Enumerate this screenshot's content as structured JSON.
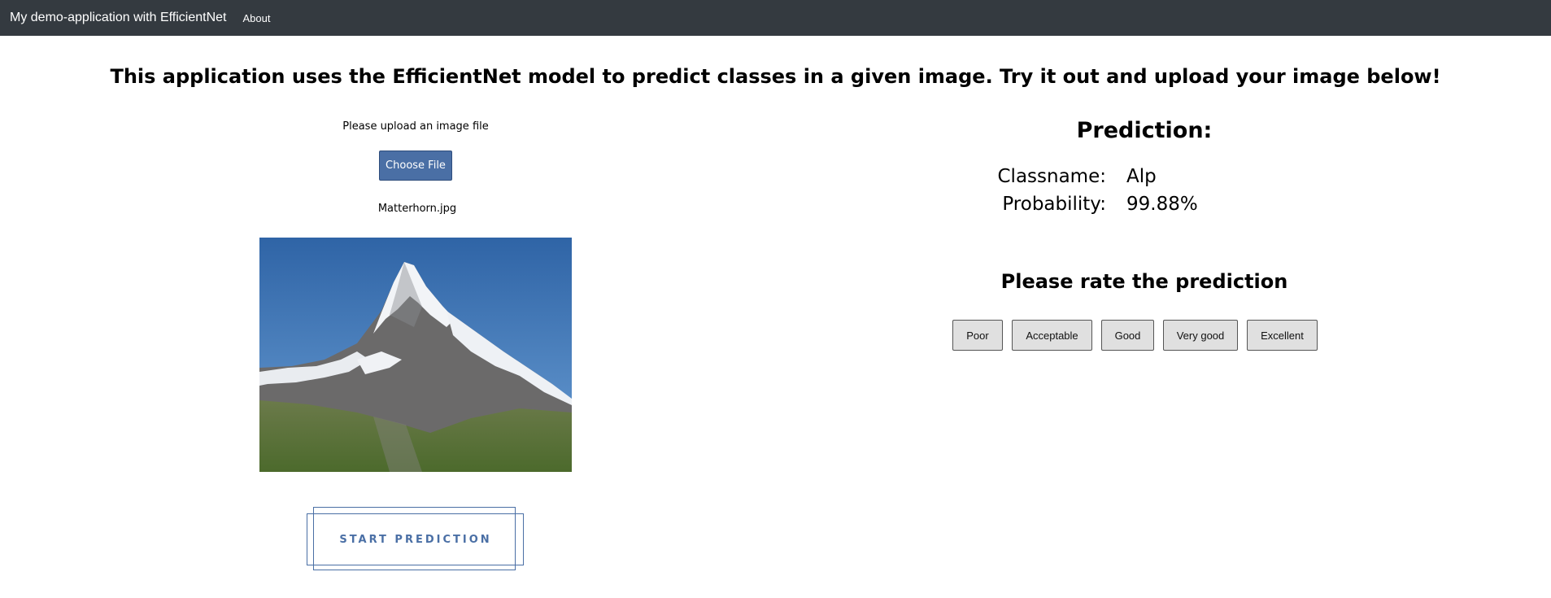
{
  "navbar": {
    "brand": "My demo-application with EfficientNet",
    "about_label": "About",
    "background": "#343a40"
  },
  "headline": "This application uses the EfficientNet model to predict classes in a given image. Try it out and upload your image below!",
  "upload": {
    "prompt": "Please upload an image file",
    "choose_button": "Choose File",
    "filename": "Matterhorn.jpg",
    "start_button": "START PREDICTION",
    "accent": "#4a6fa5"
  },
  "prediction": {
    "title": "Prediction:",
    "classname_key": "Classname:",
    "classname_value": "Alp",
    "probability_key": "Probability:",
    "probability_value": "99.88%"
  },
  "rating": {
    "title": "Please rate the prediction",
    "options": [
      "Poor",
      "Acceptable",
      "Good",
      "Very good",
      "Excellent"
    ]
  }
}
